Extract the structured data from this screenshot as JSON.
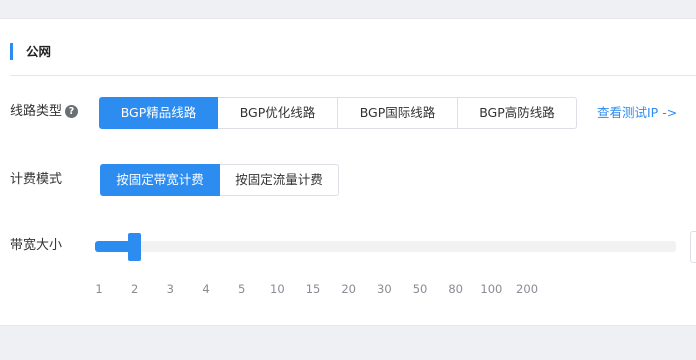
{
  "section": {
    "title": "公网"
  },
  "line_type": {
    "label": "线路类型",
    "help_icon": "question-circle-icon",
    "options": [
      "BGP精品线路",
      "BGP优化线路",
      "BGP国际线路",
      "BGP高防线路"
    ],
    "selected_index": 0,
    "test_ip_link": "查看测试IP ->"
  },
  "billing": {
    "label": "计费模式",
    "options": [
      "按固定带宽计费",
      "按固定流量计费"
    ],
    "selected_index": 0
  },
  "bandwidth": {
    "label": "带宽大小",
    "ticks": [
      "1",
      "2",
      "3",
      "4",
      "5",
      "10",
      "15",
      "20",
      "30",
      "50",
      "80",
      "100",
      "200"
    ],
    "value": "2"
  },
  "colors": {
    "accent": "#2d8cf0",
    "track": "#f2f2f3",
    "text": "#333333",
    "tick_text": "#888c93"
  }
}
